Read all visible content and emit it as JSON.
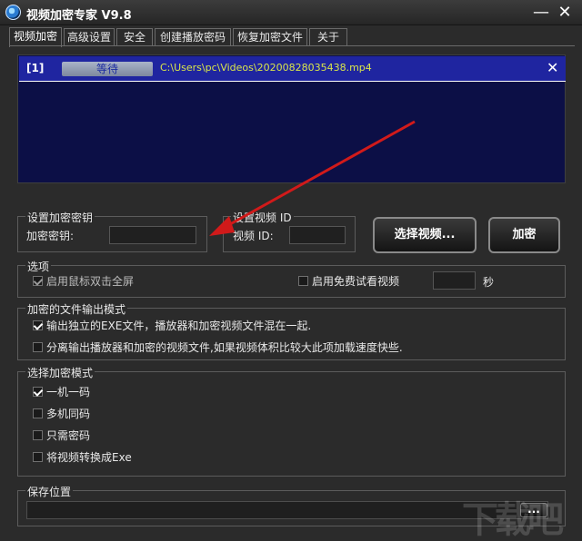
{
  "window": {
    "title": "视频加密专家 V9.8",
    "minimize": "—",
    "close": "✕"
  },
  "tabs": [
    {
      "label": "视频加密",
      "active": true
    },
    {
      "label": "高级设置"
    },
    {
      "label": "安全"
    },
    {
      "label": "创建播放密码"
    },
    {
      "label": "恢复加密文件"
    },
    {
      "label": "关于"
    }
  ],
  "video_list": {
    "rows": [
      {
        "index": "[1]",
        "status": "等待",
        "path": "C:\\Users\\pc\\Videos\\20200828035438.mp4",
        "remove": "✕"
      }
    ]
  },
  "key_group": {
    "title": "设置加密密钥",
    "label": "加密密钥:",
    "value": ""
  },
  "id_group": {
    "title": "设置视频 ID",
    "label": "视频 ID:",
    "value": ""
  },
  "buttons": {
    "select_video": "选择视频...",
    "encrypt": "加密",
    "browse": "..."
  },
  "options": {
    "title": "选项",
    "fullscreen": {
      "label": "启用鼠标双击全屏",
      "checked": true,
      "disabled": true
    },
    "trial": {
      "label": "启用免费试看视频",
      "checked": false,
      "value": "",
      "unit": "秒"
    }
  },
  "output_mode": {
    "title": "加密的文件输出模式",
    "items": [
      {
        "label": "输出独立的EXE文件，播放器和加密视频文件混在一起.",
        "checked": true
      },
      {
        "label": "分离输出播放器和加密的视频文件,如果视频体积比较大此项加载速度快些.",
        "checked": false
      }
    ]
  },
  "encrypt_mode": {
    "title": "选择加密模式",
    "items": [
      {
        "label": "一机一码",
        "checked": true
      },
      {
        "label": "多机同码",
        "checked": false
      },
      {
        "label": "只需密码",
        "checked": false
      },
      {
        "label": "将视频转换成Exe",
        "checked": false
      }
    ]
  },
  "save": {
    "title": "保存位置",
    "value": ""
  },
  "colors": {
    "list_bg": "#0c0f46",
    "row_bg": "#1f25a0",
    "path_text": "#d9e64a",
    "arrow": "#d11a1a"
  }
}
